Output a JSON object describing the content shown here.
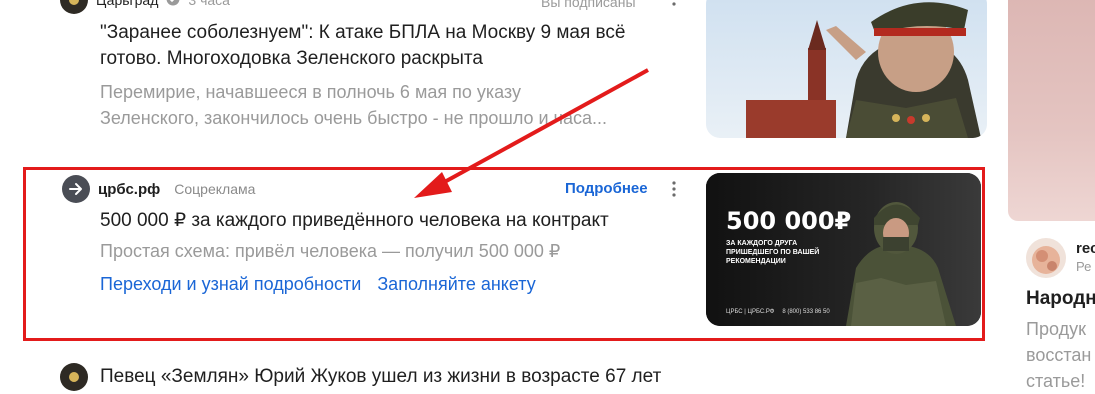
{
  "feed": {
    "item1": {
      "source": "Царьград",
      "time": "3 часа",
      "subscribed_label": "Вы подписаны",
      "title_line1": "\"Заранее соболезнуем\": К атаке БПЛА на Москву 9 мая всё",
      "title_line2": "готово. Многоходовка Зеленского раскрыта",
      "snippet_line1": "Перемирие, начавшееся в полночь 6 мая по указу",
      "snippet_line2": "Зеленского, закончилось очень быстро - не прошло и часа..."
    },
    "ad": {
      "domain": "црбс.рф",
      "label": "Соцреклама",
      "more_label": "Подробнее",
      "title": "500 000 ₽ за каждого приведённого человека на контракт",
      "snippet": "Простая схема: привёл человека — получил 500 000 ₽",
      "link1": "Переходи и узнай подробности",
      "link2": "Заполняйте анкету",
      "banner": {
        "amount": "500 000₽",
        "line1": "ЗА КАЖДОГО ДРУГА",
        "line2": "ПРИШЕДШЕГО ПО ВАШЕЙ",
        "line3": "РЕКОМЕНДАЦИИ",
        "brand": "ЦРБС | ЦРБС.РФ",
        "phone": "8 (800) 533 86 50"
      }
    },
    "item3": {
      "title": "Певец «Землян» Юрий Жуков ушел из жизни в возрасте 67 лет"
    }
  },
  "right": {
    "author_short": "rec",
    "author_sub": "Ре",
    "title": "Народн",
    "snippet_line1": "Продук",
    "snippet_line2": "восстан",
    "snippet_line3": "статье!"
  },
  "colors": {
    "link": "#1a66d6",
    "highlight": "#e31b1b",
    "muted": "#9a9a9a"
  }
}
